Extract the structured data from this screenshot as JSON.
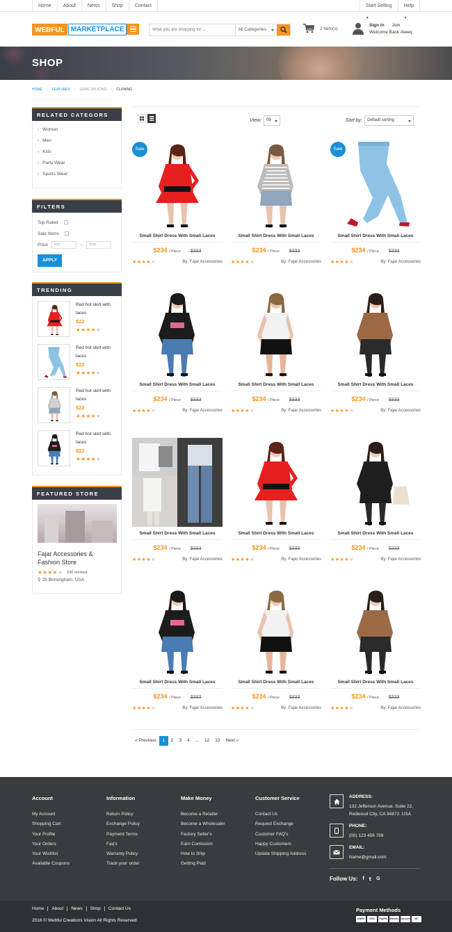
{
  "topbar": {
    "links": [
      "Home",
      "About",
      "News",
      "Shop",
      "Contact"
    ],
    "start_selling": "Start Selling",
    "help": "Help"
  },
  "header": {
    "logo_part1": "WEBFUL",
    "logo_part2": "MARKETPLACE",
    "search_placeholder": "What you are shopping for ...",
    "category_select": "All Categories",
    "cart_count": "2 Item(s)",
    "sign_in": "Sign in",
    "join": "Join",
    "welcome": "Welcome Back Ateeq"
  },
  "banner": {
    "title": "SHOP"
  },
  "breadcrumb": [
    "HOME",
    "FEATURES",
    "GENE SPLICING",
    "CLONING"
  ],
  "sidebar": {
    "related_title": "RELATED CATEGORS",
    "categories": [
      "Women",
      "Men",
      "Kids",
      "Party Wear",
      "Sports Wear"
    ],
    "filters_title": "FILTERS",
    "top_rated": "Top Rated",
    "sale_items": "Sale Items",
    "price_label": "Price",
    "min_placeholder": "min",
    "max_placeholder": "max",
    "apply": "APPLY",
    "trending_title": "TRENDING",
    "trending": [
      {
        "name": "Red hot skirt with laces",
        "price": "$22",
        "rating": 4
      },
      {
        "name": "Red hot skirt with laces",
        "price": "$22",
        "rating": 4
      },
      {
        "name": "Red hot skirt with laces",
        "price": "$22",
        "rating": 4
      },
      {
        "name": "Red hot skirt with laces",
        "price": "$22",
        "rating": 4
      }
    ],
    "featured_title": "FEATURED STORE",
    "store_name": "Fajar Accessories & Fashion Store",
    "store_reviews": "230 reviews",
    "store_rating": 4,
    "store_location": "25 Birmingham, USA"
  },
  "toolbar": {
    "view_label": "View:",
    "view_value": "09",
    "sort_label": "Sort by:",
    "sort_value": "Default sorting"
  },
  "products": [
    {
      "name": "Small Shirt Dress With Small Laces",
      "price": "$234",
      "unit": "/ Piece",
      "old": "$333",
      "by": "By: Fajar Accessories",
      "sale": "Sale",
      "img": "red"
    },
    {
      "name": "Small Shirt Dress With Small Laces",
      "price": "$234",
      "unit": "/ Piece",
      "old": "$333",
      "by": "By: Fajar Accessories",
      "sale": "",
      "img": "stripe"
    },
    {
      "name": "Small Shirt Dress With Small Laces",
      "price": "$234",
      "unit": "/ Piece",
      "old": "$333",
      "by": "By: Fajar Accessories",
      "sale": "Sale",
      "img": "jeans"
    },
    {
      "name": "Small Shirt Dress With Small Laces",
      "price": "$234",
      "unit": "/ Piece",
      "old": "$333",
      "by": "By: Fajar Accessories",
      "sale": "",
      "img": "black"
    },
    {
      "name": "Small Shirt Dress With Small Laces",
      "price": "$234",
      "unit": "/ Piece",
      "old": "$333",
      "by": "By: Fajar Accessories",
      "sale": "",
      "img": "white"
    },
    {
      "name": "Small Shirt Dress With Small Laces",
      "price": "$234",
      "unit": "/ Piece",
      "old": "$333",
      "by": "By: Fajar Accessories",
      "sale": "",
      "img": "brown"
    },
    {
      "name": "Small Shirt Dress With Small Laces",
      "price": "$234",
      "unit": "/ Piece",
      "old": "$333",
      "by": "By: Fajar Accessories",
      "sale": "",
      "img": "collage"
    },
    {
      "name": "Small Shirt Dress With Small Laces",
      "price": "$234",
      "unit": "/ Piece",
      "old": "$333",
      "by": "By: Fajar Accessories",
      "sale": "",
      "img": "red"
    },
    {
      "name": "Small Shirt Dress With Small Laces",
      "price": "$234",
      "unit": "/ Piece",
      "old": "$333",
      "by": "By: Fajar Accessories",
      "sale": "",
      "img": "coat"
    },
    {
      "name": "Small Shirt Dress With Small Laces",
      "price": "$234",
      "unit": "/ Piece",
      "old": "$333",
      "by": "By: Fajar Accessories",
      "sale": "",
      "img": "black"
    },
    {
      "name": "Small Shirt Dress With Small Laces",
      "price": "$234",
      "unit": "/ Piece",
      "old": "$333",
      "by": "By: Fajar Accessories",
      "sale": "",
      "img": "white"
    },
    {
      "name": "Small Shirt Dress With Small Laces",
      "price": "$234",
      "unit": "/ Piece",
      "old": "$333",
      "by": "By: Fajar Accessories",
      "sale": "",
      "img": "brown"
    }
  ],
  "product_rating": 4,
  "pagination": [
    "« Previous",
    "1",
    "2",
    "3",
    "4",
    "...",
    "12",
    "13",
    "Next »"
  ],
  "footer": {
    "account_title": "Account",
    "account": [
      "My Account",
      "Shopping Cart",
      "Your Profile",
      "Your Orders",
      "Your Wishlist",
      "Available Coupons"
    ],
    "info_title": "Information",
    "info": [
      "Return Policy",
      "Exchange Policy",
      "Payment Terms",
      "Faq's",
      "Warranty Policy",
      "Track your order"
    ],
    "money_title": "Make Money",
    "money": [
      "Become a Retailer",
      "Become a Wholesaler",
      "Factory Seller's",
      "Earn Comission",
      "How to Ship",
      "Getting Paid"
    ],
    "service_title": "Customer Service",
    "service": [
      "Contact Us",
      "Request Exchange",
      "Customer FAQ's",
      "Happy Customers",
      "Update Shipping Address"
    ],
    "address_title": "ADDRESS:",
    "address": "132 Jefferson Avenue, Suite 22, Redwood City, CA 94872, USA",
    "address_line1": "132 Jefferson Avenue, Suite 22,",
    "address_line2": "Redwood City, CA 94872, USA",
    "phone_title": "PHONE:",
    "phone": "(00) 123 456 789",
    "email_title": "EMAIL:",
    "email": "Name@gmail.com",
    "follow": "Follow Us:",
    "bottom_links": [
      "Home",
      "About",
      "News",
      "Shop",
      "Contact Us"
    ],
    "copyright": "2016 © Webful Creations Vision All Rights Reserved.",
    "payment_title": "Payment Methods",
    "payment_icons": [
      "AMEX",
      "VISA",
      "PayPal",
      "Maestro",
      "Discover",
      "MC"
    ]
  },
  "colors": {
    "accent": "#f7941d",
    "brand": "#1a8fd8",
    "dark": "#3a3f47"
  }
}
